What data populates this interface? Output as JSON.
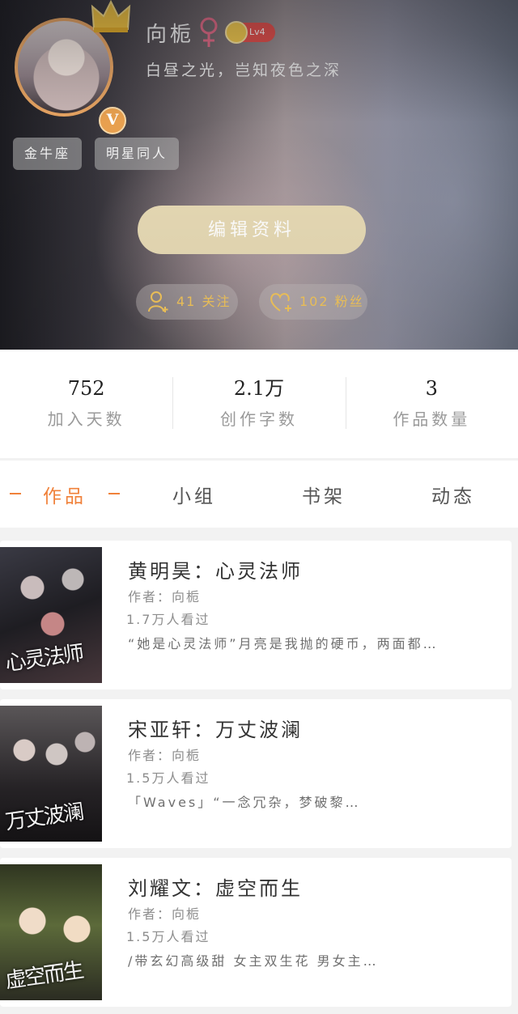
{
  "profile": {
    "username": "向栀",
    "gender_icon": "female-icon",
    "level": "Lv4",
    "bio": "白昼之光，岂知夜色之深",
    "verified_badge": "V",
    "tags": [
      "金牛座",
      "明星同人"
    ],
    "edit_button": "编辑资料",
    "following": "41 关注",
    "fans": "102 粉丝"
  },
  "stats": [
    {
      "value": "752",
      "label": "加入天数"
    },
    {
      "value": "2.1万",
      "label": "创作字数"
    },
    {
      "value": "3",
      "label": "作品数量"
    }
  ],
  "tabs": [
    "作品",
    "小组",
    "书架",
    "动态"
  ],
  "active_tab": "作品",
  "works": [
    {
      "title": "黄明昊：心灵法师",
      "author": "作者：向栀",
      "views": "1.7万人看过",
      "description": "“她是心灵法师”月亮是我抛的硬币，两面都…",
      "cover_text": "心灵法师"
    },
    {
      "title": "宋亚轩：万丈波澜",
      "author": "作者：向栀",
      "views": "1.5万人看过",
      "description": "「Waves」“一念冗杂，梦破黎…",
      "cover_text": "万丈波澜"
    },
    {
      "title": "刘耀文：虚空而生",
      "author": "作者：向栀",
      "views": "1.5万人看过",
      "description": "/带玄幻高级甜 女主双生花 男女主…",
      "cover_text": "虚空而生"
    }
  ],
  "colors": {
    "accent": "#f0813a",
    "gold": "#f1c45a",
    "edit_button_bg": "#e6d9b4",
    "level_badge": "#e24e4a"
  }
}
